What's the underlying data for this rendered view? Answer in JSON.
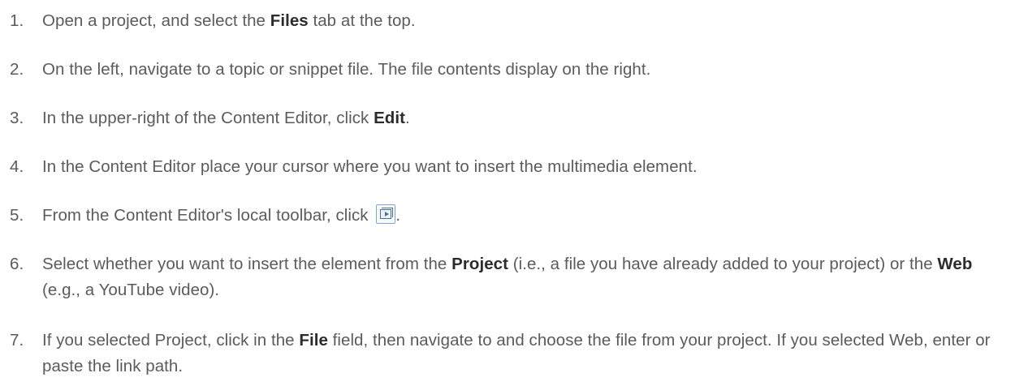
{
  "steps": [
    {
      "number": "1.",
      "parts": [
        "Open a project, and select the ",
        "Files",
        " tab at the top."
      ]
    },
    {
      "number": "2.",
      "text": "On the left, navigate to a topic or snippet file. The file contents display on the right."
    },
    {
      "number": "3.",
      "parts": [
        "In the upper-right of the Content Editor, click ",
        "Edit",
        "."
      ]
    },
    {
      "number": "4.",
      "text": "In the Content Editor place your cursor where you want to insert the multimedia element."
    },
    {
      "number": "5.",
      "parts": [
        "From the Content Editor's local toolbar, click ",
        "."
      ],
      "icon": "insert-multimedia-icon"
    },
    {
      "number": "6.",
      "parts": [
        "Select whether you want to insert the element from the ",
        "Project",
        " (i.e., a file you have already added to your project) or the ",
        "Web",
        " (e.g., a YouTube video)."
      ]
    },
    {
      "number": "7.",
      "parts": [
        "If you selected Project, click in the ",
        "File",
        " field, then navigate to and choose the file from your project. If you selected Web, enter or paste the link path."
      ]
    }
  ],
  "colors": {
    "body_text": "#5b5b5b",
    "bold_text": "#2c2c2c",
    "icon_border": "#7fa7cf"
  }
}
